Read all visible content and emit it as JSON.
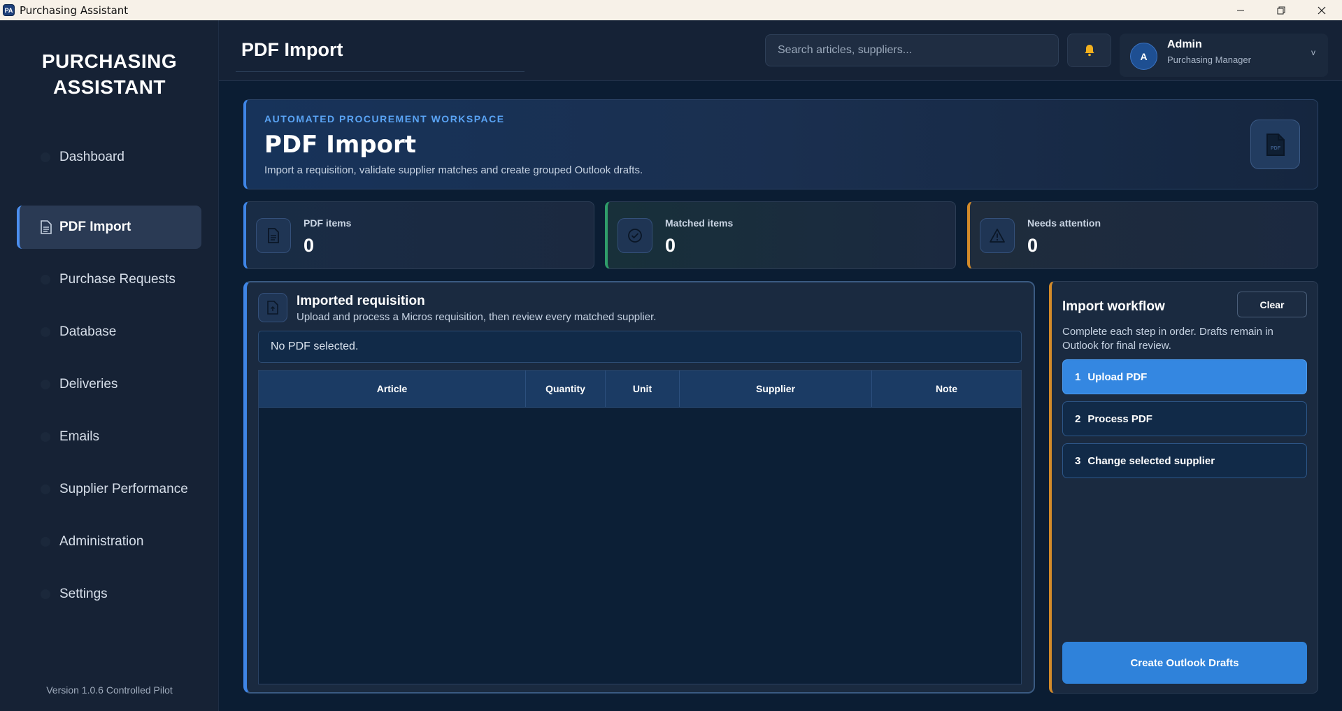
{
  "window": {
    "title": "Purchasing Assistant",
    "app_icon": "PA",
    "controls": [
      "minimize",
      "restore",
      "close"
    ]
  },
  "sidebar": {
    "brand_line1": "PURCHASING",
    "brand_line2": "ASSISTANT",
    "items": [
      {
        "label": "Dashboard"
      },
      {
        "label": "PDF Import",
        "active": true
      },
      {
        "label": "Purchase Requests"
      },
      {
        "label": "Database"
      },
      {
        "label": "Deliveries"
      },
      {
        "label": "Emails"
      },
      {
        "label": "Supplier Performance"
      },
      {
        "label": "Administration"
      },
      {
        "label": "Settings"
      }
    ],
    "version": "Version 1.0.6 Controlled Pilot"
  },
  "header": {
    "title": "PDF Import",
    "search_placeholder": "Search articles, suppliers...",
    "bell_icon": "bell-icon",
    "user": {
      "initial": "A",
      "name": "Admin",
      "role": "Purchasing Manager",
      "chevron": "v"
    }
  },
  "hero": {
    "eyebrow": "AUTOMATED PROCUREMENT WORKSPACE",
    "title": "PDF Import",
    "subtitle": "Import a requisition, validate supplier matches and create grouped Outlook drafts.",
    "icon": "pdf-file-icon"
  },
  "stats": [
    {
      "label": "PDF items",
      "value": "0",
      "icon": "document-icon",
      "accent": "#3f85e6"
    },
    {
      "label": "Matched items",
      "value": "0",
      "icon": "check-circle-icon",
      "accent": "#2f9d6a"
    },
    {
      "label": "Needs attention",
      "value": "0",
      "icon": "warning-icon",
      "accent": "#d28a2a"
    }
  ],
  "requisition": {
    "title": "Imported requisition",
    "subtitle": "Upload and process a Micros requisition, then review every matched supplier.",
    "file_status": "No PDF selected.",
    "columns": [
      "Article",
      "Quantity",
      "Unit",
      "Supplier",
      "Note"
    ],
    "rows": []
  },
  "workflow": {
    "title": "Import workflow",
    "clear_label": "Clear",
    "subtitle": "Complete each step in order. Drafts remain in Outlook for final review.",
    "steps": [
      {
        "num": "1",
        "label": "Upload PDF",
        "active": true
      },
      {
        "num": "2",
        "label": "Process PDF"
      },
      {
        "num": "3",
        "label": "Change selected supplier"
      }
    ],
    "create_label": "Create Outlook Drafts"
  },
  "colors": {
    "accent": "#3f85e6",
    "success": "#2f9d6a",
    "warning": "#d28a2a",
    "background": "#0b1d33"
  }
}
